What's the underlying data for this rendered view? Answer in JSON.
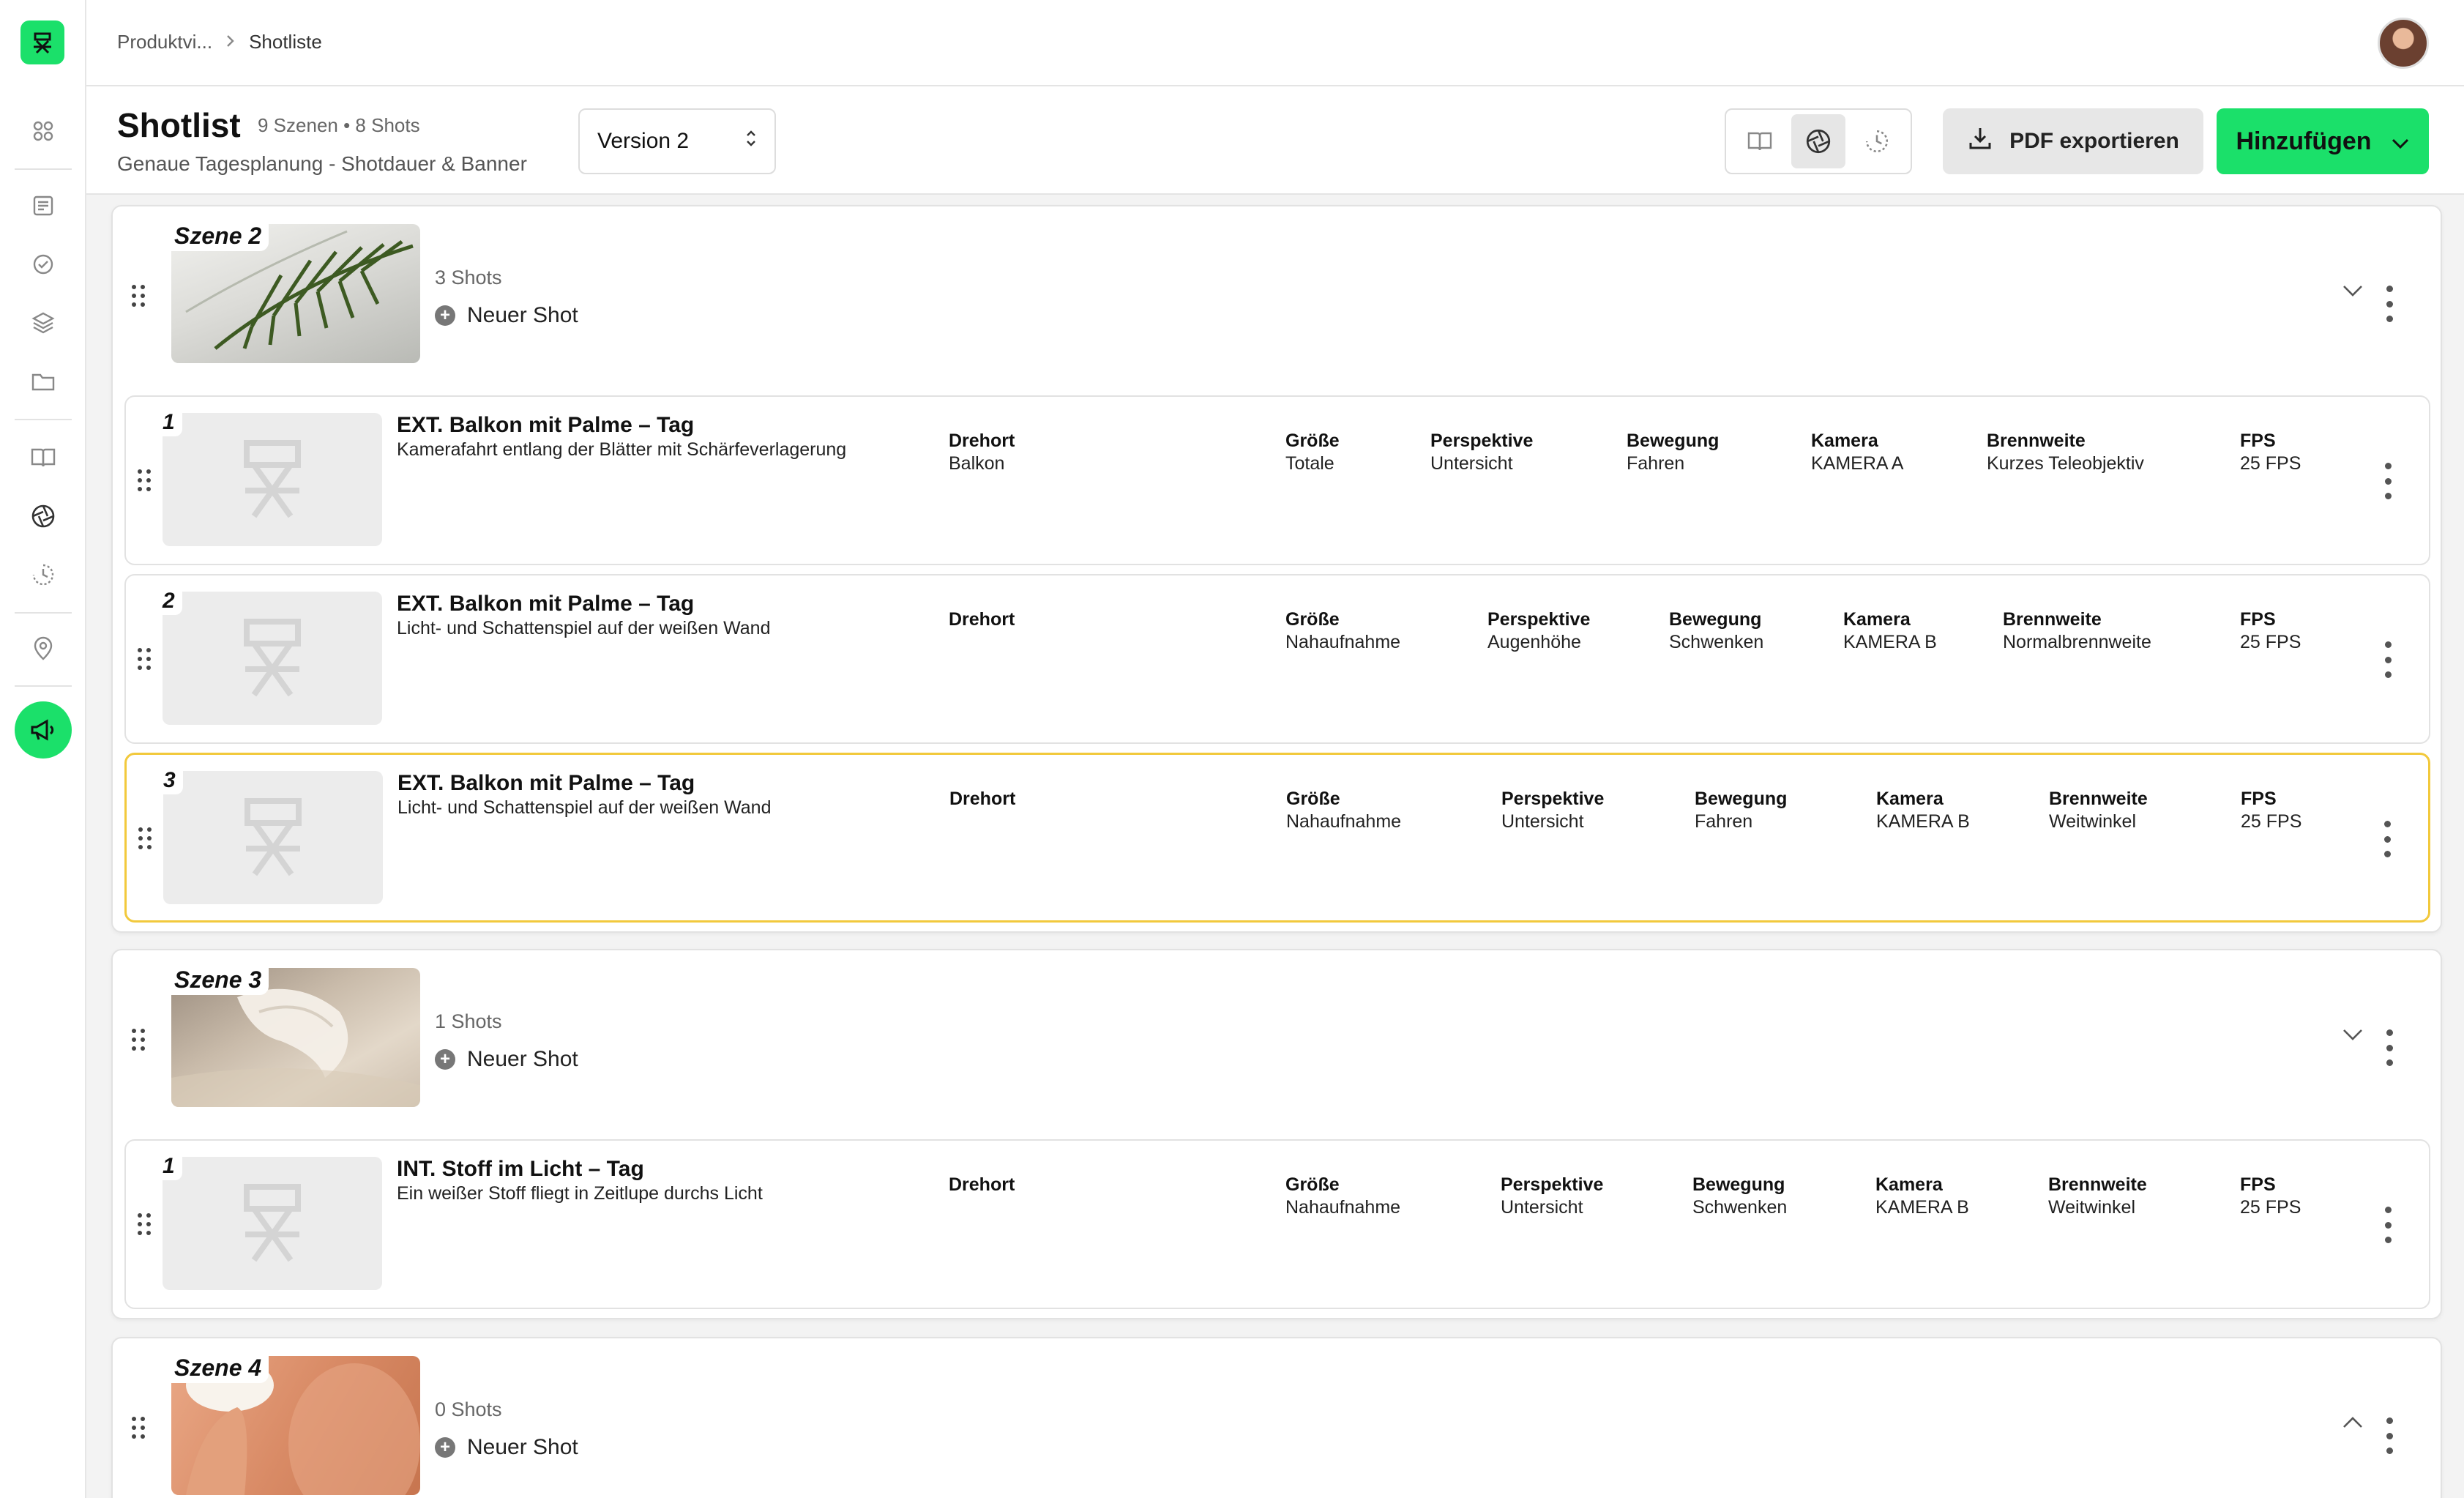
{
  "breadcrumb": {
    "parent": "Produktvi...",
    "current": "Shotliste"
  },
  "header": {
    "title": "Shotlist",
    "meta": "9 Szenen • 8 Shots",
    "subtitle": "Genaue Tagesplanung - Shotdauer & Banner",
    "version_label": "Version 2",
    "pdf_button": "PDF exportieren",
    "add_button": "Hinzufügen"
  },
  "colors": {
    "accent": "#1be06a",
    "highlight": "#f2c93c"
  },
  "sidebar": {
    "icons": [
      "grid-icon",
      "notes-icon",
      "check-icon",
      "layers-icon",
      "folder-icon",
      "book-icon",
      "aperture-icon",
      "clock-icon",
      "location-icon",
      "megaphone-icon"
    ]
  },
  "shot_labels": {
    "location": "Drehort",
    "size": "Größe",
    "perspective": "Perspektive",
    "movement": "Bewegung",
    "camera": "Kamera",
    "focal": "Brennweite",
    "fps": "FPS"
  },
  "new_shot_label": "Neuer Shot",
  "scenes": [
    {
      "label": "Szene 2",
      "shot_count": "3 Shots",
      "shots": [
        {
          "num": "1",
          "title": "EXT. Balkon mit Palme – Tag",
          "desc": "Kamerafahrt entlang der Blätter mit Schärfeverlagerung",
          "location": "Balkon",
          "size": "Totale",
          "perspective": "Untersicht",
          "movement": "Fahren",
          "camera": "KAMERA A",
          "focal": "Kurzes Teleobjektiv",
          "fps": "25 FPS"
        },
        {
          "num": "2",
          "title": "EXT. Balkon mit Palme – Tag",
          "desc": "Licht- und Schattenspiel auf der weißen Wand",
          "location": "",
          "size": "Nahaufnahme",
          "perspective": "Augenhöhe",
          "movement": "Schwenken",
          "camera": "KAMERA B",
          "focal": "Normalbrennweite",
          "fps": "25 FPS"
        },
        {
          "num": "3",
          "title": "EXT. Balkon mit Palme – Tag",
          "desc": "Licht- und Schattenspiel auf der weißen Wand",
          "location": "",
          "size": "Nahaufnahme",
          "perspective": "Untersicht",
          "movement": "Fahren",
          "camera": "KAMERA B",
          "focal": "Weitwinkel",
          "fps": "25 FPS"
        }
      ]
    },
    {
      "label": "Szene 3",
      "shot_count": "1 Shots",
      "shots": [
        {
          "num": "1",
          "title": "INT. Stoff im Licht – Tag",
          "desc": "Ein weißer Stoff fliegt in Zeitlupe durchs Licht",
          "location": "",
          "size": "Nahaufnahme",
          "perspective": "Untersicht",
          "movement": "Schwenken",
          "camera": "KAMERA B",
          "focal": "Weitwinkel",
          "fps": "25 FPS"
        }
      ]
    },
    {
      "label": "Szene 4",
      "shot_count": "0 Shots",
      "shots": []
    }
  ]
}
